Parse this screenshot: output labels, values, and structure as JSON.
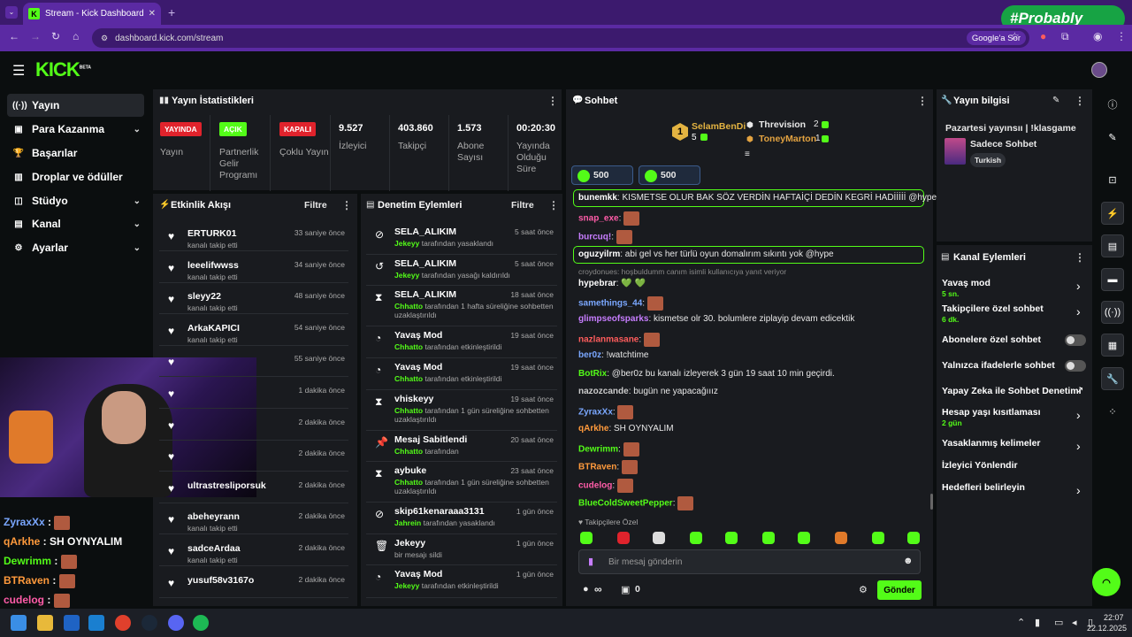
{
  "browser": {
    "tab_title": "Stream - Kick Dashboard",
    "url": "dashboard.kick.com/stream",
    "search_chip": "Google'a Sor",
    "overlay_badge": "#Probably"
  },
  "brand": {
    "logo": "KICK",
    "beta": "BETA",
    "accent": "#53fc18"
  },
  "nav": [
    {
      "label": "Yayın",
      "icon": "stream-icon"
    },
    {
      "label": "Para Kazanma",
      "icon": "money-icon"
    },
    {
      "label": "Başarılar",
      "icon": "trophy-icon"
    },
    {
      "label": "Droplar ve ödüller",
      "icon": "gift-icon"
    },
    {
      "label": "Stüdyo",
      "icon": "studio-icon"
    },
    {
      "label": "Kanal",
      "icon": "channel-icon"
    },
    {
      "label": "Ayarlar",
      "icon": "settings-icon"
    }
  ],
  "stats": {
    "title": "Yayın İstatistikleri",
    "items": [
      {
        "badge": "YAYINDA",
        "label": "Yayın"
      },
      {
        "badge": "AÇIK",
        "label": "Partnerlik Gelir Programı"
      },
      {
        "badge": "KAPALI",
        "label": "Çoklu Yayın"
      },
      {
        "value": "9.527",
        "label": "İzleyici"
      },
      {
        "value": "403.860",
        "label": "Takipçi"
      },
      {
        "value": "1.573",
        "label": "Abone Sayısı"
      },
      {
        "value": "00:20:30",
        "label": "Yayında Olduğu Süre"
      }
    ]
  },
  "activity": {
    "title": "Etkinlik Akışı",
    "filter": "Filtre",
    "rows": [
      {
        "name": "ERTURK01",
        "sub": "kanalı takip etti",
        "time": "33 saniye önce"
      },
      {
        "name": "leeelifwwss",
        "sub": "kanalı takip etti",
        "time": "34 saniye önce"
      },
      {
        "name": "sleyy22",
        "sub": "kanalı takip etti",
        "time": "48 saniye önce"
      },
      {
        "name": "ArkaKAPICI",
        "sub": "kanalı takip etti",
        "time": "54 saniye önce"
      },
      {
        "name": "",
        "sub": "",
        "time": "55 saniye önce"
      },
      {
        "name": "",
        "sub": "",
        "time": "1 dakika önce"
      },
      {
        "name": "",
        "sub": "",
        "time": "2 dakika önce"
      },
      {
        "name": "",
        "sub": "",
        "time": "2 dakika önce"
      },
      {
        "name": "ultrastresliporsuk",
        "sub": "",
        "time": "2 dakika önce"
      },
      {
        "name": "abeheyrann",
        "sub": "kanalı takip etti",
        "time": "2 dakika önce"
      },
      {
        "name": "sadceArdaa",
        "sub": "kanalı takip etti",
        "time": "2 dakika önce"
      },
      {
        "name": "yusuf58v3167o",
        "sub": "",
        "time": "2 dakika önce"
      }
    ]
  },
  "moderation": {
    "title": "Denetim Eylemleri",
    "filter": "Filtre",
    "rows": [
      {
        "name": "SELA_ALIKIM",
        "by": "Jekeyy",
        "sub": "tarafından yasaklandı",
        "time": "5 saat önce"
      },
      {
        "name": "SELA_ALIKIM",
        "by": "Jekeyy",
        "sub": "tarafından yasağı kaldırıldı",
        "time": "5 saat önce"
      },
      {
        "name": "SELA_ALIKIM",
        "by": "Chhatto",
        "sub": "tarafından 1 hafta süreliğine sohbetten uzaklaştırıldı",
        "time": "18 saat önce"
      },
      {
        "name": "Yavaş Mod",
        "by": "Chhatto",
        "sub": "tarafından etkinleştirildi",
        "time": "19 saat önce"
      },
      {
        "name": "Yavaş Mod",
        "by": "Chhatto",
        "sub": "tarafından etkinleştirildi",
        "time": "19 saat önce"
      },
      {
        "name": "vhiskeyy",
        "by": "Chhatto",
        "sub": "tarafından 1 gün süreliğine sohbetten uzaklaştırıldı",
        "time": "19 saat önce"
      },
      {
        "name": "Mesaj Sabitlendi",
        "by": "Chhatto",
        "sub": "tarafından",
        "time": "20 saat önce"
      },
      {
        "name": "aybuke",
        "by": "Chhatto",
        "sub": "tarafından 1 gün süreliğine sohbetten uzaklaştırıldı",
        "time": "23 saat önce"
      },
      {
        "name": "skip61kenaraaa3131",
        "by": "Jahrein",
        "sub": "tarafından yasaklandı",
        "time": "1 gün önce"
      },
      {
        "name": "Jekeyy",
        "by": "",
        "sub": "bir mesajı sildi",
        "time": "1 gün önce"
      },
      {
        "name": "Yavaş Mod",
        "by": "Jekeyy",
        "sub": "tarafından etkinleştirildi",
        "time": "1 gün önce"
      }
    ]
  },
  "chat": {
    "title": "Sohbet",
    "leaders": [
      {
        "rank": "1",
        "name": "SelamBenDi",
        "count": "5"
      },
      {
        "name": "Threvision",
        "count": "2"
      },
      {
        "name": "ToneyMarton",
        "count": "1"
      }
    ],
    "goals": [
      "500",
      "500"
    ],
    "messages": [
      {
        "user": "bunemkk",
        "text": " KISMETSE OLUR BAK SÖZ VERDİN HAFTAİÇİ DEDİN KEGRİ HADİİİİİ @hype",
        "color": "#e8e8e8",
        "highlight": true
      },
      {
        "user": "snap_exe",
        "text": "",
        "color": "#ff5ca8"
      },
      {
        "user": "burcuq!",
        "text": "",
        "color": "#c77dff"
      },
      {
        "user": "oguzyilrm",
        "text": " abi gel vs her türlü oyun domalırım sıkıntı yok @hype",
        "color": "#e8e8e8",
        "highlight": true
      },
      {
        "user": "",
        "text": "croydonues: hoşbuldumm canım isimli kullanıcıya yanıt veriyor",
        "color": "#888"
      },
      {
        "user": "hypebrar",
        "text": " 💚 💚",
        "color": "#ffffff"
      },
      {
        "user": "samethings_44",
        "text": "",
        "color": "#7aa7ff"
      },
      {
        "user": "glimpseofsparks",
        "text": " kismetse olr 30. bolumlere ziplayip devam edicektik",
        "color": "#c77dff"
      },
      {
        "user": "nazlanmasane",
        "text": "",
        "color": "#ff5c5c"
      },
      {
        "user": "ber0z",
        "text": " !watchtime",
        "color": "#7aa7ff"
      },
      {
        "user": "BotRix",
        "text": " @ber0z bu kanalı izleyerek 3 gün 19 saat 10 min geçirdi.",
        "color": "#53fc18"
      },
      {
        "user": "nazozcande",
        "text": " bugün ne yapacağııız",
        "color": "#cccccc"
      },
      {
        "user": "ZyraxXx",
        "text": "",
        "color": "#7aa7ff"
      },
      {
        "user": "qArkhe",
        "text": " SH OYNYALIM",
        "color": "#ff9a3c"
      },
      {
        "user": "Dewrimm",
        "text": "",
        "color": "#53fc18"
      },
      {
        "user": "BTRaven",
        "text": "",
        "color": "#ff9a3c"
      },
      {
        "user": "cudelog",
        "text": "",
        "color": "#ff5ca8"
      },
      {
        "user": "BlueColdSweetPepper",
        "text": "",
        "color": "#53fc18"
      }
    ],
    "followers_only": "Takipçilere Özel",
    "input_placeholder": "Bir mesaj gönderin",
    "points": "∞",
    "store_count": "0",
    "send": "Gönder"
  },
  "stream_info": {
    "title": "Yayın bilgisi",
    "stream_title": "Pazartesi yayınsıı | !klasgame",
    "category": "Sadece Sohbet",
    "tag": "Turkish"
  },
  "channel_actions": {
    "title": "Kanal Eylemleri",
    "rows": [
      {
        "label": "Yavaş mod",
        "sub": "5 sn.",
        "control": "chevron"
      },
      {
        "label": "Takipçilere özel sohbet",
        "sub": "6 dk.",
        "control": "chevron"
      },
      {
        "label": "Abonelere özel sohbet",
        "sub": "",
        "control": "toggle"
      },
      {
        "label": "Yalnızca ifadelerle sohbet",
        "sub": "",
        "control": "toggle"
      },
      {
        "label": "Yapay Zeka ile Sohbet Denetimi",
        "sub": "",
        "control": "external"
      },
      {
        "label": "Hesap yaşı kısıtlaması",
        "sub": "2 gün",
        "control": "chevron"
      },
      {
        "label": "Yasaklanmış kelimeler",
        "sub": "",
        "control": "chevron"
      },
      {
        "label": "İzleyici Yönlendir",
        "sub": "",
        "control": "none"
      },
      {
        "label": "Hedefleri belirleyin",
        "sub": "",
        "control": "chevron"
      }
    ]
  },
  "webcam_overlay_chat": [
    {
      "user": "ZyraxXx",
      "text": " :",
      "color": "#7aa7ff"
    },
    {
      "user": "qArkhe",
      "text": " : SH OYNYALIM",
      "color": "#ff9a3c"
    },
    {
      "user": "Dewrimm",
      "text": " :",
      "color": "#53fc18"
    },
    {
      "user": "BTRaven",
      "text": " :",
      "color": "#ff9a3c"
    },
    {
      "user": "cudelog",
      "text": " :",
      "color": "#ff5ca8"
    }
  ],
  "taskbar": {
    "time": "22:07",
    "date": "22.12.2025"
  }
}
